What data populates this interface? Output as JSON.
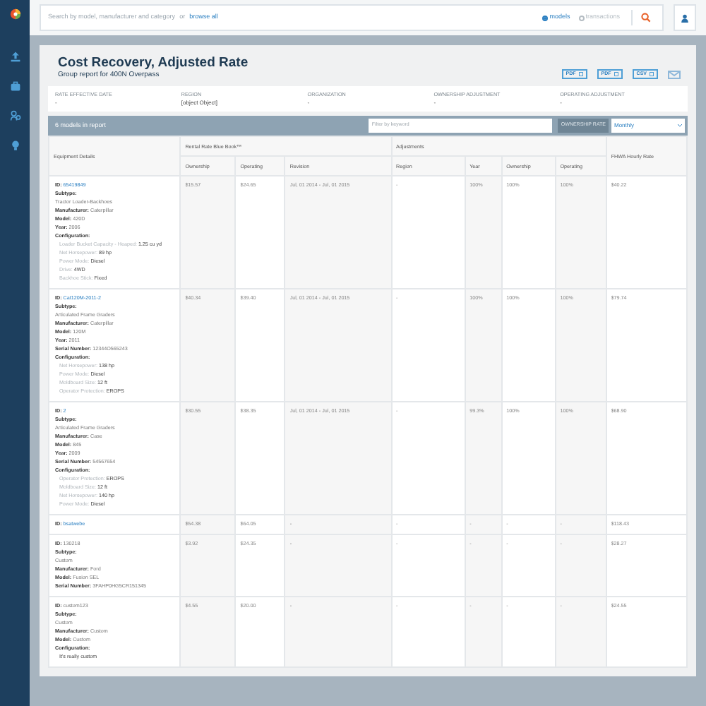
{
  "search": {
    "placeholder": "Search by model, manufacturer and category",
    "or_text": "or",
    "browse_link": "browse all",
    "modes": [
      {
        "label": "models",
        "selected": true
      },
      {
        "label": "transactions",
        "selected": false
      }
    ]
  },
  "report": {
    "title": "Cost Recovery, Adjusted Rate",
    "subtitle": "Group report for 400N Overpass",
    "exports": [
      {
        "label": "PDF",
        "kind": "file"
      },
      {
        "label": "PDF",
        "kind": "file"
      },
      {
        "label": "CSV",
        "kind": "file"
      },
      {
        "kind": "email"
      }
    ],
    "info": [
      {
        "label": "RATE EFFECTIVE DATE",
        "value": "-"
      },
      {
        "label": "REGION",
        "value": "[object Object]"
      },
      {
        "label": "ORGANIZATION",
        "value": "-"
      },
      {
        "label": "OWNERSHIP ADJUSTMENT",
        "value": "-"
      },
      {
        "label": "OPERATING ADJUSTMENT",
        "value": "-"
      }
    ],
    "count_text": "6 models in report",
    "filter_placeholder": "Filter by keyword",
    "rate_label": "OWNERSHIP RATE",
    "rate_value": "Monthly"
  },
  "table": {
    "columns": {
      "details": "Equipment Details",
      "group_rental": "Rental Rate Blue Book™",
      "group_adjust": "Adjustments",
      "fhwa": "FHWA Hourly Rate",
      "sub": [
        "Ownership",
        "Operating",
        "Revision",
        "Region",
        "Year",
        "Ownership",
        "Operating"
      ]
    },
    "rows": [
      {
        "details": [
          {
            "kind": "field",
            "label": "ID:",
            "value": "65419849",
            "link": true
          },
          {
            "kind": "block",
            "label": "Subtype:",
            "value": "Tractor Loader-Backhoes"
          },
          {
            "kind": "field",
            "label": "Manufacturer:",
            "value": "Caterpillar",
            "link": false
          },
          {
            "kind": "field",
            "label": "Model:",
            "value": "420D",
            "link": false
          },
          {
            "kind": "field",
            "label": "Year:",
            "value": "2006",
            "link": false
          },
          {
            "kind": "config",
            "label": "Configuration:",
            "items": [
              {
                "label": "Loader Bucket Capacity - Heaped:",
                "value": "1.25 cu yd"
              },
              {
                "label": "Net Horsepower:",
                "value": "89 hp"
              },
              {
                "label": "Power Mode:",
                "value": "Diesel"
              },
              {
                "label": "Drive:",
                "value": "4WD"
              },
              {
                "label": "Backhoe Stick:",
                "value": "Fixed"
              }
            ]
          }
        ],
        "cells": [
          "$15.57",
          "$24.65",
          "Jul, 01 2014 - Jul, 01 2015",
          "-",
          "100%",
          "100%",
          "100%",
          "$40.22"
        ]
      },
      {
        "details": [
          {
            "kind": "field",
            "label": "ID:",
            "value": "Cat120M-2011-2",
            "link": true
          },
          {
            "kind": "block",
            "label": "Subtype:",
            "value": "Articulated Frame Graders"
          },
          {
            "kind": "field",
            "label": "Manufacturer:",
            "value": "Caterpillar",
            "link": false
          },
          {
            "kind": "field",
            "label": "Model:",
            "value": "120M",
            "link": false
          },
          {
            "kind": "field",
            "label": "Year:",
            "value": "2011",
            "link": false
          },
          {
            "kind": "field",
            "label": "Serial Number:",
            "value": "12344O565243",
            "link": false
          },
          {
            "kind": "config",
            "label": "Configuration:",
            "items": [
              {
                "label": "Net Horsepower:",
                "value": "138 hp"
              },
              {
                "label": "Power Mode:",
                "value": "Diesel"
              },
              {
                "label": "Moldboard Size:",
                "value": "12 ft"
              },
              {
                "label": "Operator Protection:",
                "value": "EROPS"
              }
            ]
          }
        ],
        "cells": [
          "$40.34",
          "$39.40",
          "Jul, 01 2014 - Jul, 01 2015",
          "-",
          "100%",
          "100%",
          "100%",
          "$79.74"
        ]
      },
      {
        "details": [
          {
            "kind": "field",
            "label": "ID:",
            "value": "2",
            "link": true
          },
          {
            "kind": "block",
            "label": "Subtype:",
            "value": "Articulated Frame Graders"
          },
          {
            "kind": "field",
            "label": "Manufacturer:",
            "value": "Case",
            "link": false
          },
          {
            "kind": "field",
            "label": "Model:",
            "value": "845",
            "link": false
          },
          {
            "kind": "field",
            "label": "Year:",
            "value": "2009",
            "link": false
          },
          {
            "kind": "field",
            "label": "Serial Number:",
            "value": "54567654",
            "link": false
          },
          {
            "kind": "config",
            "label": "Configuration:",
            "items": [
              {
                "label": "Operator Protection:",
                "value": "EROPS"
              },
              {
                "label": "Moldboard Size:",
                "value": "12 ft"
              },
              {
                "label": "Net Horsepower:",
                "value": "140 hp"
              },
              {
                "label": "Power Mode:",
                "value": "Diesel"
              }
            ]
          }
        ],
        "cells": [
          "$30.55",
          "$38.35",
          "Jul, 01 2014 - Jul, 01 2015",
          "-",
          "99.3%",
          "100%",
          "100%",
          "$68.90"
        ]
      },
      {
        "details": [
          {
            "kind": "field",
            "label": "ID:",
            "value": "bsatwebe",
            "link": true
          }
        ],
        "cells": [
          "$54.38",
          "$64.05",
          "-",
          "-",
          "-",
          "-",
          "-",
          "$118.43"
        ]
      },
      {
        "details": [
          {
            "kind": "field",
            "label": "ID:",
            "value": "130218",
            "link": false
          },
          {
            "kind": "block",
            "label": "Subtype:",
            "value": "Custom"
          },
          {
            "kind": "field",
            "label": "Manufacturer:",
            "value": "Ford",
            "link": false
          },
          {
            "kind": "field",
            "label": "Model:",
            "value": "Fusion SEL",
            "link": false
          },
          {
            "kind": "field",
            "label": "Serial Number:",
            "value": "3FAHP0HG5CR151345",
            "link": false
          }
        ],
        "cells": [
          "$3.92",
          "$24.35",
          "-",
          "-",
          "-",
          "-",
          "-",
          "$28.27"
        ]
      },
      {
        "details": [
          {
            "kind": "field",
            "label": "ID:",
            "value": "custom123",
            "link": false
          },
          {
            "kind": "block",
            "label": "Subtype:",
            "value": "Custom"
          },
          {
            "kind": "field",
            "label": "Manufacturer:",
            "value": "Custom",
            "link": false
          },
          {
            "kind": "field",
            "label": "Model:",
            "value": "Custom",
            "link": false
          },
          {
            "kind": "config",
            "label": "Configuration:",
            "items": [
              {
                "value": "It's really custom"
              }
            ]
          }
        ],
        "cells": [
          "$4.55",
          "$20.00",
          "-",
          "-",
          "-",
          "-",
          "-",
          "$24.55"
        ]
      }
    ]
  }
}
